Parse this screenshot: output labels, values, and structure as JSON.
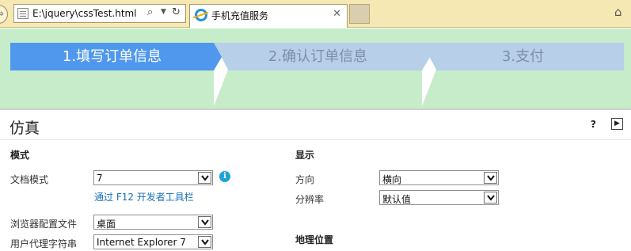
{
  "browser": {
    "address": "E:\\jquery\\cssTest.html",
    "tab_title": "手机充值服务",
    "tab_close": "✕"
  },
  "steps": [
    {
      "label": "1.填写订单信息",
      "state": "active"
    },
    {
      "label": "2.确认订单信息",
      "state": "inactive"
    },
    {
      "label": "3.支付",
      "state": "inactive"
    }
  ],
  "colors": {
    "page_bg": "#c7ecc9",
    "step_active": "#4f98ed",
    "step_inactive": "#b7cfe9",
    "link": "#1a6fb5"
  },
  "devtools": {
    "title": "仿真",
    "help": "?",
    "mode": {
      "heading": "模式",
      "document_mode_label": "文档模式",
      "document_mode_value": "7",
      "f12_link": "通过 F12 开发者工具栏",
      "browser_profile_label": "浏览器配置文件",
      "browser_profile_value": "桌面",
      "user_agent_label": "用户代理字符串",
      "user_agent_value": "Internet Explorer 7"
    },
    "display": {
      "heading": "显示",
      "orientation_label": "方向",
      "orientation_value": "横向",
      "resolution_label": "分辨率",
      "resolution_value": "默认值"
    },
    "geolocation_heading": "地理位置"
  },
  "icons": {
    "back": "back-arrow-icon",
    "search": "search-icon",
    "refresh": "refresh-icon",
    "home": "home-icon",
    "info": "info-icon",
    "collapse": "collapse-icon"
  }
}
